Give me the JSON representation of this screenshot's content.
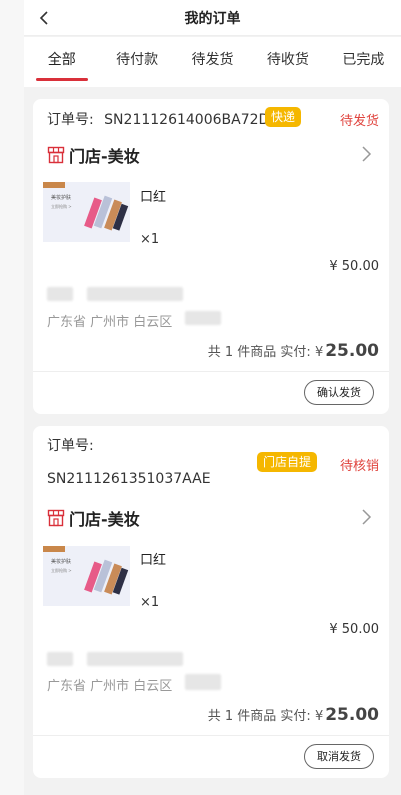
{
  "header": {
    "title": "我的订单"
  },
  "tabs": [
    {
      "label": "全部",
      "active": true
    },
    {
      "label": "待付款"
    },
    {
      "label": "待发货"
    },
    {
      "label": "待收货"
    },
    {
      "label": "已完成"
    }
  ],
  "orders": [
    {
      "order_label": "订单号:",
      "order_no": "SN21112614006BA72D",
      "badge": "快递",
      "status": "待发货",
      "shop": "门店-美妆",
      "product": {
        "name": "口红",
        "qty": "×1",
        "price": "¥ 50.00",
        "thumb_line1": "美妆护肤",
        "thumb_line2": "立即抢购 >"
      },
      "address": "广东省 广州市 白云区",
      "total_prefix": "共 1 件商品 实付: ¥",
      "total_amount": "25.00",
      "action": "确认发货"
    },
    {
      "order_label": "订单号:",
      "order_no": "SN2111261351037AAE",
      "badge": "门店自提",
      "status": "待核销",
      "shop": "门店-美妆",
      "product": {
        "name": "口红",
        "qty": "×1",
        "price": "¥ 50.00",
        "thumb_line1": "美妆护肤",
        "thumb_line2": "立即抢购 >"
      },
      "address": "广东省 广州市 白云区",
      "total_prefix": "共 1 件商品 实付: ¥",
      "total_amount": "25.00",
      "action": "取消发货"
    }
  ],
  "colors": {
    "accent": "#d9303a",
    "badge": "#f5b700",
    "status": "#e0433d"
  },
  "icons": {
    "back": "chevron-left-icon",
    "shop": "shop-icon",
    "arrow": "chevron-right-icon"
  }
}
